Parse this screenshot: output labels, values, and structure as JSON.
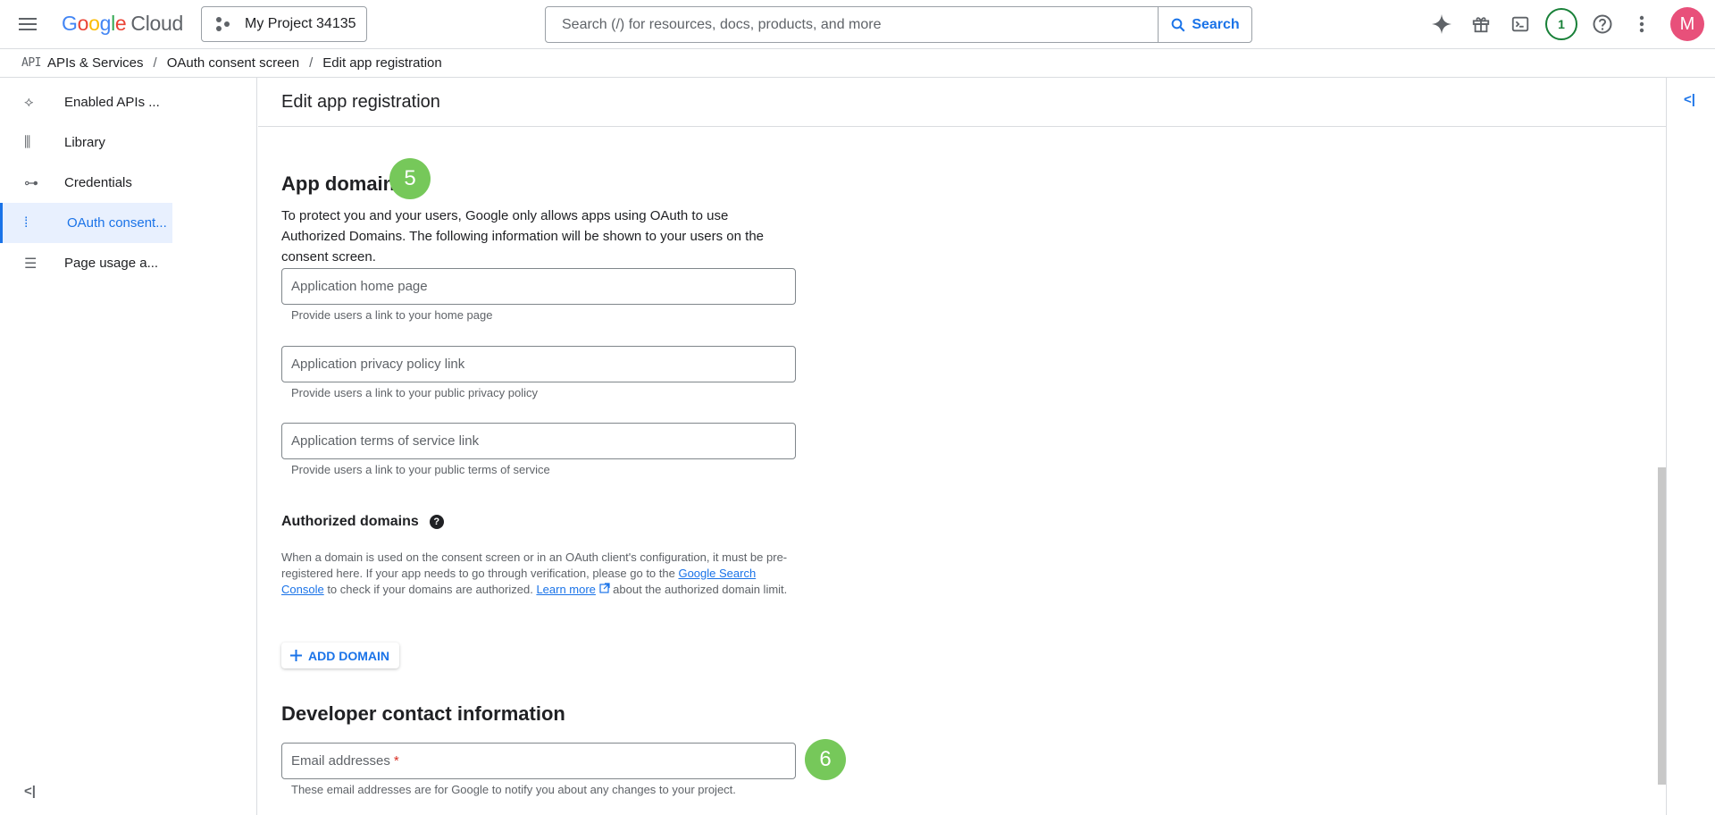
{
  "header": {
    "logo_google": [
      "G",
      "o",
      "o",
      "g",
      "l",
      "e"
    ],
    "logo_cloud": "Cloud",
    "project": "My Project 34135",
    "search_placeholder": "Search (/) for resources, docs, products, and more",
    "search_button": "Search",
    "notification_count": "1",
    "avatar_letter": "M"
  },
  "breadcrumb": {
    "api_tag": "API",
    "items": [
      "APIs & Services",
      "OAuth consent screen",
      "Edit app registration"
    ],
    "separator": "/"
  },
  "sidebar": {
    "items": [
      {
        "label": "Enabled APIs ...",
        "icon": "enabled-apis-icon",
        "glyph": "⟡"
      },
      {
        "label": "Library",
        "icon": "library-icon",
        "glyph": "⫼"
      },
      {
        "label": "Credentials",
        "icon": "key-icon",
        "glyph": "⊶"
      },
      {
        "label": "OAuth consent...",
        "icon": "consent-icon",
        "glyph": "⁞"
      },
      {
        "label": "Page usage a...",
        "icon": "page-usage-icon",
        "glyph": "☰"
      }
    ],
    "collapse_glyph": "<|"
  },
  "page": {
    "title": "Edit app registration",
    "clipped_text": "...",
    "app_domain": {
      "heading": "App domain",
      "badge": "5",
      "description": "To protect you and your users, Google only allows apps using OAuth to use Authorized Domains. The following information will be shown to your users on the consent screen.",
      "fields": [
        {
          "placeholder": "Application home page",
          "hint": "Provide users a link to your home page"
        },
        {
          "placeholder": "Application privacy policy link",
          "hint": "Provide users a link to your public privacy policy"
        },
        {
          "placeholder": "Application terms of service link",
          "hint": "Provide users a link to your public terms of service"
        }
      ]
    },
    "authorized_domains": {
      "heading": "Authorized domains",
      "help": "?",
      "text_1": "When a domain is used on the consent screen or in an OAuth client's configuration, it must be pre-registered here. If your app needs to go through verification, please go to the ",
      "link_1": "Google Search Console",
      "text_2": " to check if your domains are authorized. ",
      "link_2": "Learn more",
      "text_3": " about the authorized domain limit.",
      "add_button": "ADD DOMAIN"
    },
    "developer_contact": {
      "heading": "Developer contact information",
      "field_placeholder": "Email addresses",
      "required_mark": "*",
      "hint": "These email addresses are for Google to notify you about any changes to your project.",
      "badge": "6"
    }
  }
}
